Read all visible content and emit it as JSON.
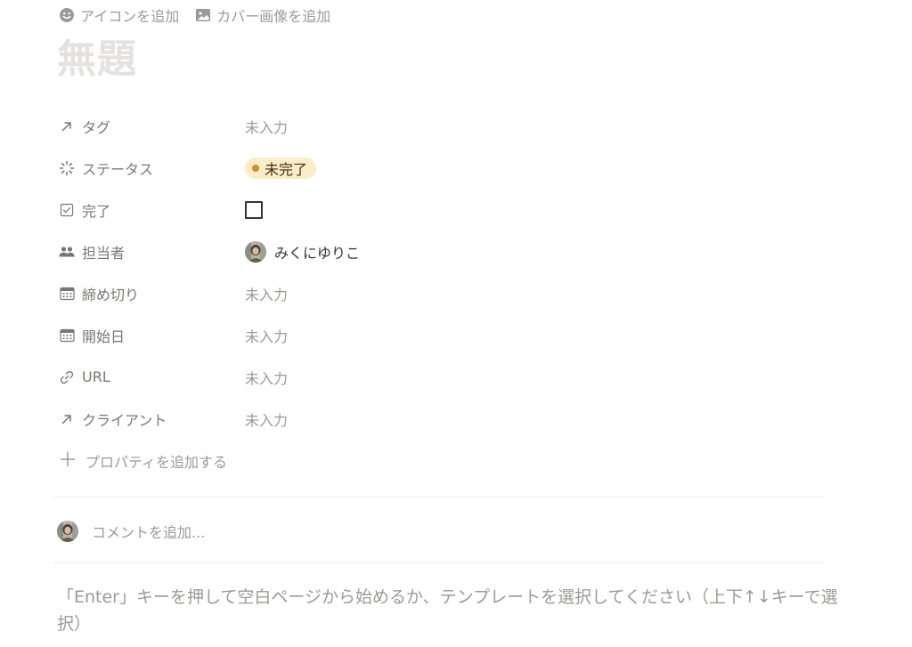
{
  "top_actions": {
    "add_icon_label": "アイコンを追加",
    "add_cover_label": "カバー画像を追加"
  },
  "page": {
    "title_placeholder": "無題"
  },
  "properties": [
    {
      "name": "タグ",
      "icon": "arrow-up-right-icon",
      "value": "未入力"
    },
    {
      "name": "ステータス",
      "icon": "status-spinner-icon",
      "value": "未完了",
      "value_color": "#cb912f",
      "pill_bg": "#fdecc8"
    },
    {
      "name": "完了",
      "icon": "checkbox-property-icon",
      "value": false
    },
    {
      "name": "担当者",
      "icon": "people-icon",
      "value": "みくにゆりこ"
    },
    {
      "name": "締め切り",
      "icon": "calendar-icon",
      "value": "未入力"
    },
    {
      "name": "開始日",
      "icon": "calendar-icon",
      "value": "未入力"
    },
    {
      "name": "URL",
      "icon": "link-icon",
      "value": "未入力"
    },
    {
      "name": "クライアント",
      "icon": "arrow-up-right-icon",
      "value": "未入力"
    }
  ],
  "add_property_label": "プロパティを追加する",
  "comment": {
    "placeholder": "コメントを追加..."
  },
  "hint_text": "「Enter」キーを押して空白ページから始めるか、テンプレートを選択してください（上下↑↓キーで選択）"
}
